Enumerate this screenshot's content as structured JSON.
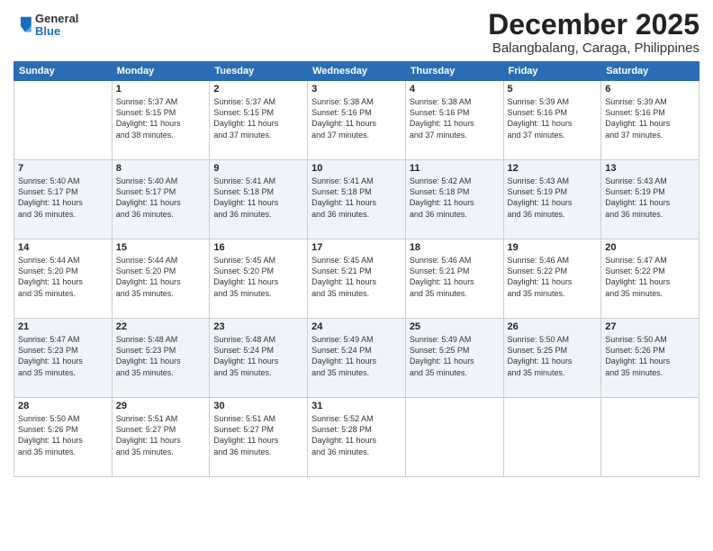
{
  "header": {
    "logo_general": "General",
    "logo_blue": "Blue",
    "month_title": "December 2025",
    "subtitle": "Balangbalang, Caraga, Philippines"
  },
  "days_of_week": [
    "Sunday",
    "Monday",
    "Tuesday",
    "Wednesday",
    "Thursday",
    "Friday",
    "Saturday"
  ],
  "weeks": [
    {
      "shaded": false,
      "days": [
        {
          "num": "",
          "content": ""
        },
        {
          "num": "1",
          "content": "Sunrise: 5:37 AM\nSunset: 5:15 PM\nDaylight: 11 hours\nand 38 minutes."
        },
        {
          "num": "2",
          "content": "Sunrise: 5:37 AM\nSunset: 5:15 PM\nDaylight: 11 hours\nand 37 minutes."
        },
        {
          "num": "3",
          "content": "Sunrise: 5:38 AM\nSunset: 5:16 PM\nDaylight: 11 hours\nand 37 minutes."
        },
        {
          "num": "4",
          "content": "Sunrise: 5:38 AM\nSunset: 5:16 PM\nDaylight: 11 hours\nand 37 minutes."
        },
        {
          "num": "5",
          "content": "Sunrise: 5:39 AM\nSunset: 5:16 PM\nDaylight: 11 hours\nand 37 minutes."
        },
        {
          "num": "6",
          "content": "Sunrise: 5:39 AM\nSunset: 5:16 PM\nDaylight: 11 hours\nand 37 minutes."
        }
      ]
    },
    {
      "shaded": true,
      "days": [
        {
          "num": "7",
          "content": "Sunrise: 5:40 AM\nSunset: 5:17 PM\nDaylight: 11 hours\nand 36 minutes."
        },
        {
          "num": "8",
          "content": "Sunrise: 5:40 AM\nSunset: 5:17 PM\nDaylight: 11 hours\nand 36 minutes."
        },
        {
          "num": "9",
          "content": "Sunrise: 5:41 AM\nSunset: 5:18 PM\nDaylight: 11 hours\nand 36 minutes."
        },
        {
          "num": "10",
          "content": "Sunrise: 5:41 AM\nSunset: 5:18 PM\nDaylight: 11 hours\nand 36 minutes."
        },
        {
          "num": "11",
          "content": "Sunrise: 5:42 AM\nSunset: 5:18 PM\nDaylight: 11 hours\nand 36 minutes."
        },
        {
          "num": "12",
          "content": "Sunrise: 5:43 AM\nSunset: 5:19 PM\nDaylight: 11 hours\nand 36 minutes."
        },
        {
          "num": "13",
          "content": "Sunrise: 5:43 AM\nSunset: 5:19 PM\nDaylight: 11 hours\nand 36 minutes."
        }
      ]
    },
    {
      "shaded": false,
      "days": [
        {
          "num": "14",
          "content": "Sunrise: 5:44 AM\nSunset: 5:20 PM\nDaylight: 11 hours\nand 35 minutes."
        },
        {
          "num": "15",
          "content": "Sunrise: 5:44 AM\nSunset: 5:20 PM\nDaylight: 11 hours\nand 35 minutes."
        },
        {
          "num": "16",
          "content": "Sunrise: 5:45 AM\nSunset: 5:20 PM\nDaylight: 11 hours\nand 35 minutes."
        },
        {
          "num": "17",
          "content": "Sunrise: 5:45 AM\nSunset: 5:21 PM\nDaylight: 11 hours\nand 35 minutes."
        },
        {
          "num": "18",
          "content": "Sunrise: 5:46 AM\nSunset: 5:21 PM\nDaylight: 11 hours\nand 35 minutes."
        },
        {
          "num": "19",
          "content": "Sunrise: 5:46 AM\nSunset: 5:22 PM\nDaylight: 11 hours\nand 35 minutes."
        },
        {
          "num": "20",
          "content": "Sunrise: 5:47 AM\nSunset: 5:22 PM\nDaylight: 11 hours\nand 35 minutes."
        }
      ]
    },
    {
      "shaded": true,
      "days": [
        {
          "num": "21",
          "content": "Sunrise: 5:47 AM\nSunset: 5:23 PM\nDaylight: 11 hours\nand 35 minutes."
        },
        {
          "num": "22",
          "content": "Sunrise: 5:48 AM\nSunset: 5:23 PM\nDaylight: 11 hours\nand 35 minutes."
        },
        {
          "num": "23",
          "content": "Sunrise: 5:48 AM\nSunset: 5:24 PM\nDaylight: 11 hours\nand 35 minutes."
        },
        {
          "num": "24",
          "content": "Sunrise: 5:49 AM\nSunset: 5:24 PM\nDaylight: 11 hours\nand 35 minutes."
        },
        {
          "num": "25",
          "content": "Sunrise: 5:49 AM\nSunset: 5:25 PM\nDaylight: 11 hours\nand 35 minutes."
        },
        {
          "num": "26",
          "content": "Sunrise: 5:50 AM\nSunset: 5:25 PM\nDaylight: 11 hours\nand 35 minutes."
        },
        {
          "num": "27",
          "content": "Sunrise: 5:50 AM\nSunset: 5:26 PM\nDaylight: 11 hours\nand 35 minutes."
        }
      ]
    },
    {
      "shaded": false,
      "days": [
        {
          "num": "28",
          "content": "Sunrise: 5:50 AM\nSunset: 5:26 PM\nDaylight: 11 hours\nand 35 minutes."
        },
        {
          "num": "29",
          "content": "Sunrise: 5:51 AM\nSunset: 5:27 PM\nDaylight: 11 hours\nand 35 minutes."
        },
        {
          "num": "30",
          "content": "Sunrise: 5:51 AM\nSunset: 5:27 PM\nDaylight: 11 hours\nand 36 minutes."
        },
        {
          "num": "31",
          "content": "Sunrise: 5:52 AM\nSunset: 5:28 PM\nDaylight: 11 hours\nand 36 minutes."
        },
        {
          "num": "",
          "content": ""
        },
        {
          "num": "",
          "content": ""
        },
        {
          "num": "",
          "content": ""
        }
      ]
    }
  ]
}
